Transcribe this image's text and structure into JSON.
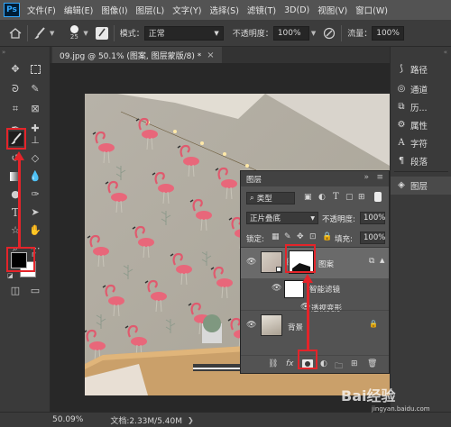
{
  "app": {
    "logo": "Ps"
  },
  "menubar": {
    "items": [
      "文件(F)",
      "编辑(E)",
      "图像(I)",
      "图层(L)",
      "文字(Y)",
      "选择(S)",
      "滤镜(T)",
      "3D(D)",
      "视图(V)",
      "窗口(W)"
    ]
  },
  "options": {
    "brush_size": "25",
    "mode_label": "模式：",
    "mode_value": "正常",
    "opacity_label": "不透明度：",
    "opacity_value": "100%",
    "flow_label": "流量：",
    "flow_value": "100%"
  },
  "document": {
    "tab_title": "09.jpg @ 50.1% (图案, 图层蒙版/8) *",
    "close": "×"
  },
  "right_panel": {
    "items": [
      "路径",
      "通道",
      "历...",
      "属性",
      "字符",
      "段落",
      "图层"
    ]
  },
  "layers_panel": {
    "title": "图层",
    "filter_kind": "类型",
    "blend_mode": "正片叠底",
    "opacity_label": "不透明度:",
    "opacity_value": "100%",
    "lock_label": "锁定:",
    "fill_label": "填充:",
    "fill_value": "100%",
    "layers": [
      {
        "name": "图案",
        "selected": true
      },
      {
        "name": "智能滤镜",
        "type": "smart-filter"
      },
      {
        "name": "透视变形",
        "type": "filter-item"
      },
      {
        "name": "背景",
        "locked": true
      }
    ],
    "footer_fx": "fx"
  },
  "statusbar": {
    "zoom": "50.09%",
    "doc_info": "文档:2.33M/5.40M"
  },
  "watermark": {
    "text": "Bai经验",
    "sub": "jingyan.baidu.com"
  },
  "colors": {
    "annotation_red": "#e4242a",
    "panel_bg": "#535353",
    "toolbar_bg": "#3a3a3a",
    "selected_layer": "#6a6a6a"
  }
}
